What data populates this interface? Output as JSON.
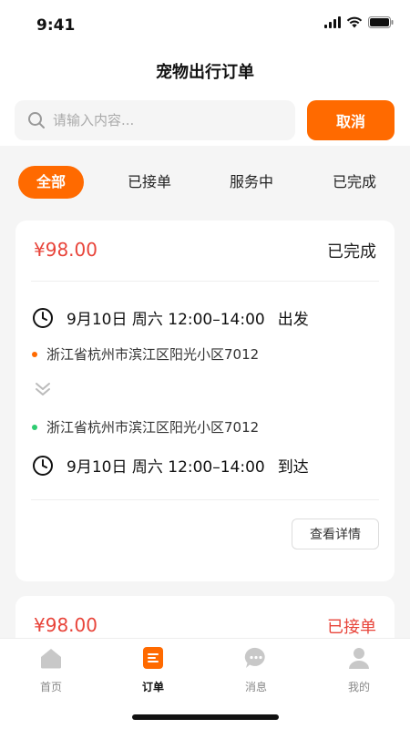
{
  "status_bar": {
    "time": "9:41"
  },
  "header": {
    "title": "宠物出行订单"
  },
  "search": {
    "placeholder": "请输入内容...",
    "value": "",
    "cancel_label": "取消"
  },
  "tabs": [
    {
      "label": "全部",
      "active": true
    },
    {
      "label": "已接单",
      "active": false
    },
    {
      "label": "服务中",
      "active": false
    },
    {
      "label": "已完成",
      "active": false
    }
  ],
  "orders": [
    {
      "price": "¥98.00",
      "status": "已完成",
      "depart_time": "9月10日  周六  12:00–14:00",
      "depart_label": "出发",
      "from_address": "浙江省杭州市滨江区阳光小区7012",
      "to_address": "浙江省杭州市滨江区阳光小区7012",
      "arrive_time": "9月10日  周六  12:00–14:00",
      "arrive_label": "到达",
      "detail_label": "查看详情"
    },
    {
      "price": "¥98.00",
      "status": "已接单"
    }
  ],
  "tabbar": [
    {
      "label": "首页",
      "icon": "home-icon"
    },
    {
      "label": "订单",
      "icon": "order-icon"
    },
    {
      "label": "消息",
      "icon": "message-icon"
    },
    {
      "label": "我的",
      "icon": "profile-icon"
    }
  ],
  "colors": {
    "accent": "#ff6a00",
    "price": "#e8443a",
    "from_dot": "#ff6a00",
    "to_dot": "#2ecc71"
  }
}
